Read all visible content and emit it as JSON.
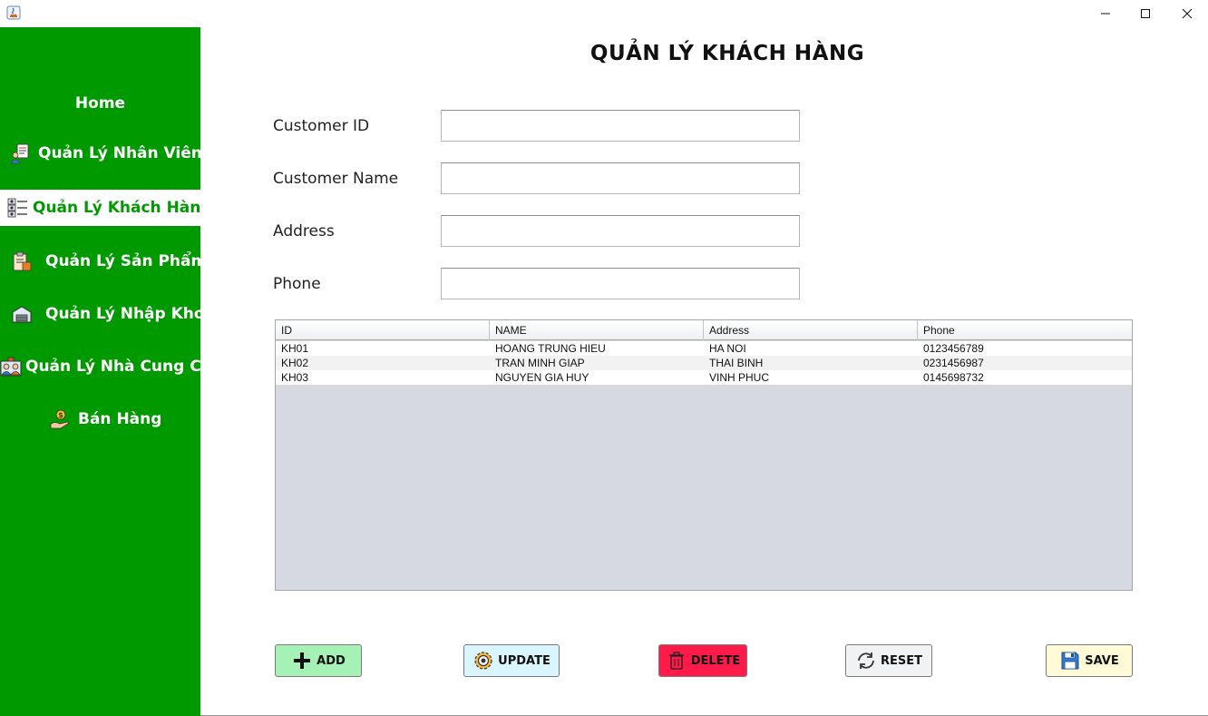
{
  "page": {
    "title": "QUẢN LÝ KHÁCH HÀNG"
  },
  "titlebar": {
    "app_icon": "java-icon",
    "controls": [
      "minimize-icon",
      "maximize-icon",
      "close-icon"
    ]
  },
  "sidebar": {
    "background_color": "#009a00",
    "home_label": "Home",
    "items": [
      {
        "label": "Quản Lý Nhân Viên",
        "icon": "employee-icon",
        "active": false
      },
      {
        "label": "Quản Lý Khách Hàng",
        "icon": "customer-list-icon",
        "active": true
      },
      {
        "label": "Quản Lý Sản Phẩm",
        "icon": "product-icon",
        "active": false
      },
      {
        "label": "Quản Lý Nhập Kho",
        "icon": "warehouse-icon",
        "active": false
      },
      {
        "label": "Quản Lý Nhà Cung Cấp",
        "icon": "supplier-icon",
        "active": false
      },
      {
        "label": "Bán Hàng",
        "icon": "sales-icon",
        "active": false
      }
    ]
  },
  "form": {
    "customer_id": {
      "label": "Customer ID",
      "value": ""
    },
    "customer_name": {
      "label": "Customer Name",
      "value": ""
    },
    "address": {
      "label": "Address",
      "value": ""
    },
    "phone": {
      "label": "Phone",
      "value": ""
    }
  },
  "table": {
    "columns": [
      "ID",
      "NAME",
      "Address",
      "Phone"
    ],
    "rows": [
      [
        "KH01",
        "HOANG TRUNG HIEU",
        "HA NOI",
        "0123456789"
      ],
      [
        "KH02",
        "TRAN MINH GIAP",
        "THAI BINH",
        "0231456987"
      ],
      [
        "KH03",
        "NGUYEN GIA HUY",
        "VINH PHUC",
        "0145698732"
      ]
    ]
  },
  "actions": {
    "add": {
      "label": "ADD",
      "icon": "plus-icon",
      "color": "#a6f2b6"
    },
    "update": {
      "label": "UPDATE",
      "icon": "gear-icon",
      "color": "#d9f6ff"
    },
    "delete": {
      "label": "DELETE",
      "icon": "trash-icon",
      "color": "#ff1a4a"
    },
    "reset": {
      "label": "RESET",
      "icon": "reset-icon",
      "color": "#f1f2f4"
    },
    "save": {
      "label": "SAVE",
      "icon": "save-icon",
      "color": "#fffbd6"
    }
  }
}
